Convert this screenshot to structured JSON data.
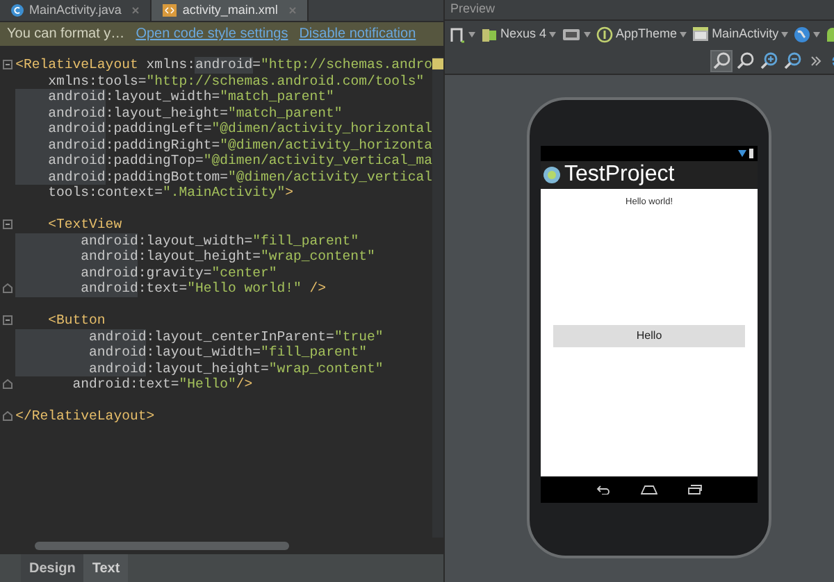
{
  "editor_tabs": [
    {
      "label": "MainActivity.java",
      "kind": "java",
      "selected": false
    },
    {
      "label": "activity_main.xml",
      "kind": "xml",
      "selected": true
    }
  ],
  "notification": {
    "text": "You can format y…",
    "links": [
      "Open code style settings",
      "Disable notification"
    ]
  },
  "code_blocks": [
    {
      "lines": [
        {
          "fold_start": true,
          "segments": [
            {
              "kind": "tag",
              "text": "<RelativeLayout"
            },
            {
              "kind": "plain",
              "text": " xmlns:"
            },
            {
              "kind": "ns",
              "text": "android"
            },
            {
              "kind": "plain",
              "text": "="
            },
            {
              "kind": "value",
              "text": "\"http://schemas.andro"
            }
          ]
        },
        {
          "segments": [
            {
              "kind": "plain",
              "text": "    xmlns:tools="
            },
            {
              "kind": "value",
              "text": "\"http://schemas.android.com/tools\""
            }
          ]
        },
        {
          "segments": [
            {
              "kind": "ns",
              "text": "    android"
            },
            {
              "kind": "plain",
              "text": ":layout_width="
            },
            {
              "kind": "value",
              "text": "\"match_parent\""
            }
          ]
        },
        {
          "segments": [
            {
              "kind": "ns",
              "text": "    android"
            },
            {
              "kind": "plain",
              "text": ":layout_height="
            },
            {
              "kind": "value",
              "text": "\"match_parent\""
            }
          ]
        },
        {
          "segments": [
            {
              "kind": "ns",
              "text": "    android"
            },
            {
              "kind": "plain",
              "text": ":paddingLeft="
            },
            {
              "kind": "value",
              "text": "\"@dimen/activity_horizontal"
            }
          ]
        },
        {
          "segments": [
            {
              "kind": "ns",
              "text": "    android"
            },
            {
              "kind": "plain",
              "text": ":paddingRight="
            },
            {
              "kind": "value",
              "text": "\"@dimen/activity_horizonta"
            }
          ]
        },
        {
          "segments": [
            {
              "kind": "ns",
              "text": "    android"
            },
            {
              "kind": "plain",
              "text": ":paddingTop="
            },
            {
              "kind": "value",
              "text": "\"@dimen/activity_vertical_ma"
            }
          ]
        },
        {
          "segments": [
            {
              "kind": "ns",
              "text": "    android"
            },
            {
              "kind": "plain",
              "text": ":paddingBottom="
            },
            {
              "kind": "value",
              "text": "\"@dimen/activity_vertical"
            }
          ]
        },
        {
          "segments": [
            {
              "kind": "plain",
              "text": "    tools:context="
            },
            {
              "kind": "value",
              "text": "\".MainActivity\""
            },
            {
              "kind": "tag",
              "text": ">"
            }
          ]
        }
      ]
    },
    {
      "lines": [
        {
          "fold_start": true,
          "segments": [
            {
              "kind": "tag",
              "text": "    <TextView"
            }
          ]
        },
        {
          "segments": [
            {
              "kind": "ns",
              "text": "        android"
            },
            {
              "kind": "plain",
              "text": ":layout_width="
            },
            {
              "kind": "value",
              "text": "\"fill_parent\""
            }
          ]
        },
        {
          "segments": [
            {
              "kind": "ns",
              "text": "        android"
            },
            {
              "kind": "plain",
              "text": ":layout_height="
            },
            {
              "kind": "value",
              "text": "\"wrap_content\""
            }
          ]
        },
        {
          "segments": [
            {
              "kind": "ns",
              "text": "        android"
            },
            {
              "kind": "plain",
              "text": ":gravity="
            },
            {
              "kind": "value",
              "text": "\"center\""
            }
          ]
        },
        {
          "fold_end": true,
          "segments": [
            {
              "kind": "ns",
              "text": "        android"
            },
            {
              "kind": "plain",
              "text": ":text="
            },
            {
              "kind": "value",
              "text": "\"Hello world!\""
            },
            {
              "kind": "tag",
              "text": " />"
            }
          ]
        }
      ]
    },
    {
      "lines": [
        {
          "fold_start": true,
          "segments": [
            {
              "kind": "tag",
              "text": "    <Button"
            }
          ]
        },
        {
          "segments": [
            {
              "kind": "ns",
              "text": "         android"
            },
            {
              "kind": "plain",
              "text": ":layout_centerInParent="
            },
            {
              "kind": "value",
              "text": "\"true\""
            }
          ]
        },
        {
          "segments": [
            {
              "kind": "ns",
              "text": "         android"
            },
            {
              "kind": "plain",
              "text": ":layout_width="
            },
            {
              "kind": "value",
              "text": "\"fill_parent\""
            }
          ]
        },
        {
          "segments": [
            {
              "kind": "ns",
              "text": "         android"
            },
            {
              "kind": "plain",
              "text": ":layout_height="
            },
            {
              "kind": "value",
              "text": "\"wrap_content\""
            }
          ]
        },
        {
          "fold_end": true,
          "segments": [
            {
              "kind": "plain",
              "text": "       android:text="
            },
            {
              "kind": "value",
              "text": "\"Hello\""
            },
            {
              "kind": "tag",
              "text": "/>"
            }
          ]
        }
      ]
    },
    {
      "lines": [
        {
          "fold_end": true,
          "segments": [
            {
              "kind": "tag",
              "text": "</RelativeLayout>"
            }
          ]
        }
      ]
    }
  ],
  "bottom_tabs": [
    {
      "label": "Design",
      "selected": false
    },
    {
      "label": "Text",
      "selected": true
    }
  ],
  "preview": {
    "title": "Preview",
    "toolbar": [
      {
        "kind": "layout"
      },
      {
        "kind": "device",
        "label": "Nexus 4"
      },
      {
        "kind": "orientation"
      },
      {
        "kind": "theme",
        "label": "AppTheme"
      },
      {
        "kind": "activity",
        "label": "MainActivity"
      },
      {
        "kind": "locale"
      },
      {
        "kind": "api"
      }
    ],
    "zoom_tools": [
      {
        "kind": "zoom-fit",
        "selected": true
      },
      {
        "kind": "zoom-actual",
        "selected": false
      },
      {
        "kind": "zoom-in",
        "selected": false
      },
      {
        "kind": "zoom-out",
        "selected": false
      },
      {
        "kind": "more",
        "selected": false
      },
      {
        "kind": "settings",
        "selected": false
      }
    ],
    "device": {
      "app_title": "TestProject",
      "text_view": "Hello world!",
      "button": "Hello"
    }
  }
}
